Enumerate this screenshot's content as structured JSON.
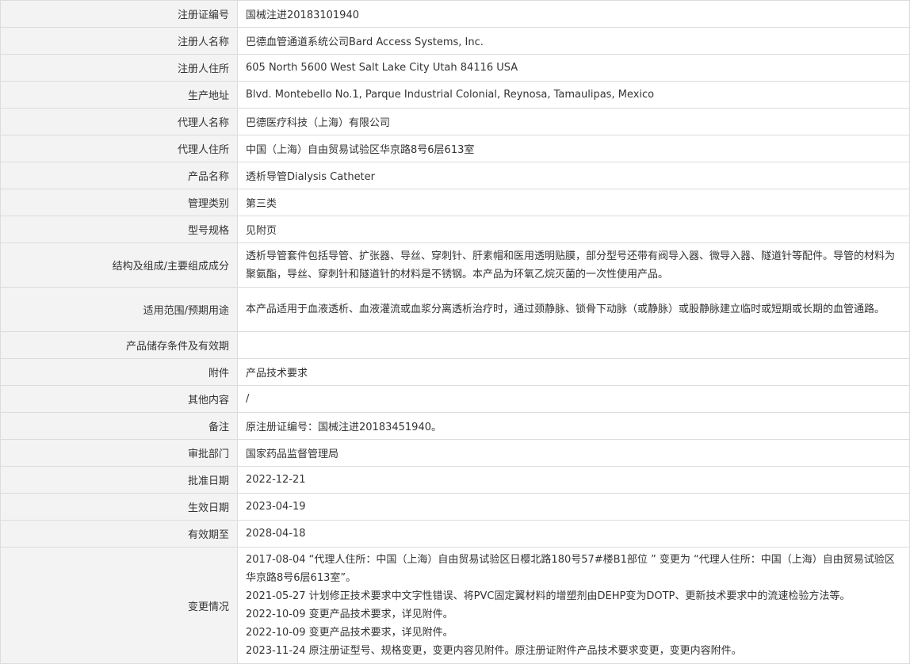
{
  "rows": [
    {
      "label": "注册证编号",
      "value": "国械注进20183101940"
    },
    {
      "label": "注册人名称",
      "value": "巴德血管通道系统公司Bard Access Systems, Inc."
    },
    {
      "label": "注册人住所",
      "value": "605 North 5600 West Salt Lake City Utah 84116 USA"
    },
    {
      "label": "生产地址",
      "value": "Blvd. Montebello No.1, Parque Industrial Colonial, Reynosa, Tamaulipas, Mexico"
    },
    {
      "label": "代理人名称",
      "value": "巴德医疗科技（上海）有限公司"
    },
    {
      "label": "代理人住所",
      "value": "中国（上海）自由贸易试验区华京路8号6层613室"
    },
    {
      "label": "产品名称",
      "value": "透析导管Dialysis Catheter"
    },
    {
      "label": "管理类别",
      "value": "第三类"
    },
    {
      "label": "型号规格",
      "value": "见附页"
    },
    {
      "label": "结构及组成/主要组成成分",
      "value": "透析导管套件包括导管、扩张器、导丝、穿刺针、肝素帽和医用透明贴膜，部分型号还带有阀导入器、微导入器、隧道针等配件。导管的材料为聚氨酯，导丝、穿刺针和隧道针的材料是不锈钢。本产品为环氧乙烷灭菌的一次性使用产品。"
    },
    {
      "label": "适用范围/预期用途",
      "value": "本产品适用于血液透析、血液灌流或血浆分离透析治疗时，通过颈静脉、锁骨下动脉（或静脉）或股静脉建立临时或短期或长期的血管通路。"
    },
    {
      "label": "产品储存条件及有效期",
      "value": ""
    },
    {
      "label": "附件",
      "value": "产品技术要求"
    },
    {
      "label": "其他内容",
      "value": "/"
    },
    {
      "label": "备注",
      "value": "原注册证编号：国械注进20183451940。"
    },
    {
      "label": "审批部门",
      "value": "国家药品监督管理局"
    },
    {
      "label": "批准日期",
      "value": "2022-12-21"
    },
    {
      "label": "生效日期",
      "value": "2023-04-19"
    },
    {
      "label": "有效期至",
      "value": "2028-04-18"
    }
  ],
  "changes": {
    "label": "变更情况",
    "lines": [
      "2017-08-04 “代理人住所：中国（上海）自由贸易试验区日樱北路180号57#楼B1部位 ” 变更为 “代理人住所：中国（上海）自由贸易试验区华京路8号6层613室”。",
      "2021-05-27 计划修正技术要求中文字性错误、将PVC固定翼材料的增塑剂由DEHP变为DOTP、更新技术要求中的流速检验方法等。",
      "2022-10-09 变更产品技术要求，详见附件。",
      "2022-10-09 变更产品技术要求，详见附件。",
      "2023-11-24 原注册证型号、规格变更，变更内容见附件。原注册证附件产品技术要求变更，变更内容附件。"
    ]
  }
}
